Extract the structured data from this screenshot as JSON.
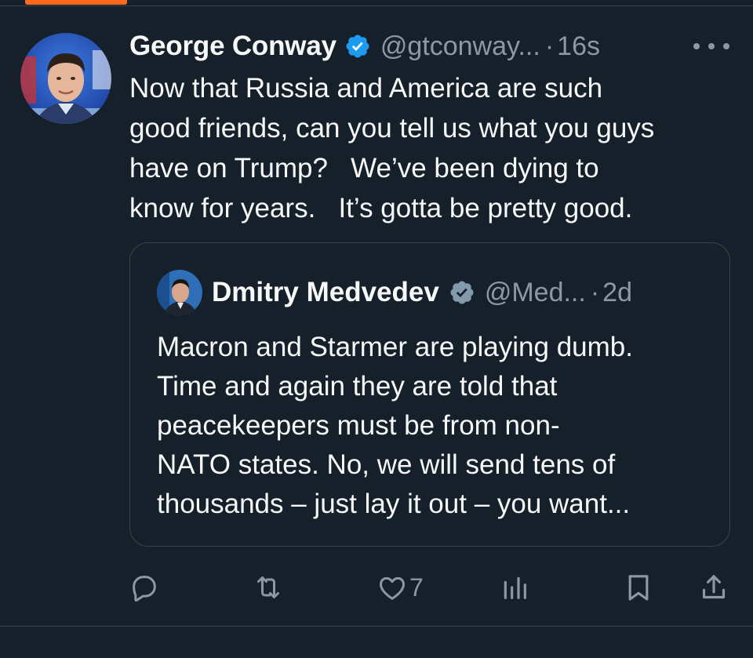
{
  "tweet": {
    "author_name": "George Conway",
    "handle": "@gtconway...",
    "separator": "·",
    "time": "16s",
    "text": "Now that Russia and America are such\ngood friends, can you tell us what you guys\nhave on Trump?   We’ve been dying to\nknow for years.   It’s gotta be pretty good."
  },
  "quote": {
    "author_name": "Dmitry Medvedev",
    "handle": "@Med...",
    "separator": "·",
    "time": "2d",
    "text": "Macron and Starmer are playing dumb.\nTime and again they are told that\npeacekeepers must be from non-\nNATO states. No, we will send tens of\nthousands – just lay it out – you want..."
  },
  "actions": {
    "reply_icon": "reply-icon",
    "retweet_icon": "retweet-icon",
    "like_icon": "like-icon",
    "like_count": "7",
    "views_icon": "views-icon",
    "bookmark_icon": "bookmark-icon",
    "share_icon": "share-icon"
  },
  "colors": {
    "background": "#15202b",
    "text_primary": "#f7f9f9",
    "text_secondary": "#8b98a5",
    "verified": "#1d9bf0",
    "verified_gray": "#829aab",
    "accent": "#ff6a1a",
    "border": "#38444d"
  }
}
